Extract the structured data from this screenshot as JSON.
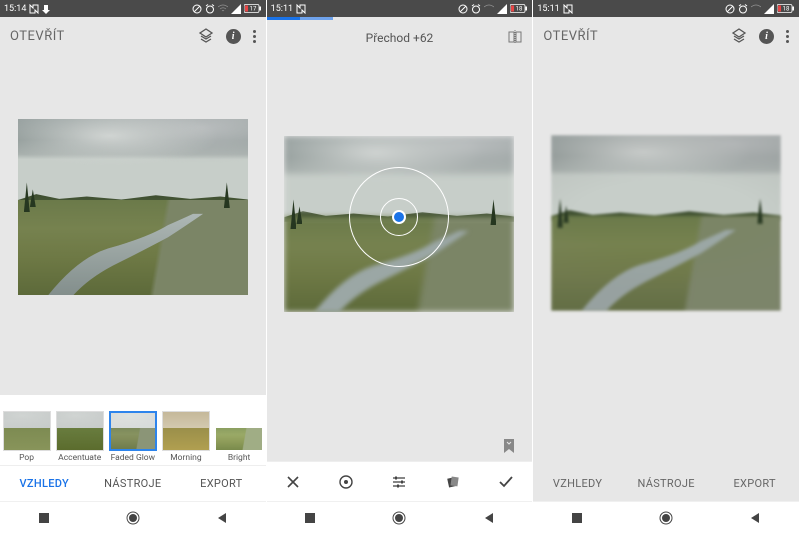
{
  "phone1": {
    "status_time": "15:14",
    "appbar_title": "OTEVŘÍT",
    "filters": [
      {
        "label": "Pop"
      },
      {
        "label": "Accentuate"
      },
      {
        "label": "Faded Glow"
      },
      {
        "label": "Morning"
      },
      {
        "label": "Bright"
      }
    ],
    "tabs": {
      "vzhledy": "VZHLEDY",
      "nastroje": "NÁSTROJE",
      "export": "EXPORT"
    }
  },
  "phone2": {
    "status_time": "15:11",
    "title": "Přechod +62"
  },
  "phone3": {
    "status_time": "15:11",
    "appbar_title": "OTEVŘÍT",
    "tabs": {
      "vzhledy": "VZHLEDY",
      "nastroje": "NÁSTROJE",
      "export": "EXPORT"
    }
  },
  "battery_pct": "18"
}
